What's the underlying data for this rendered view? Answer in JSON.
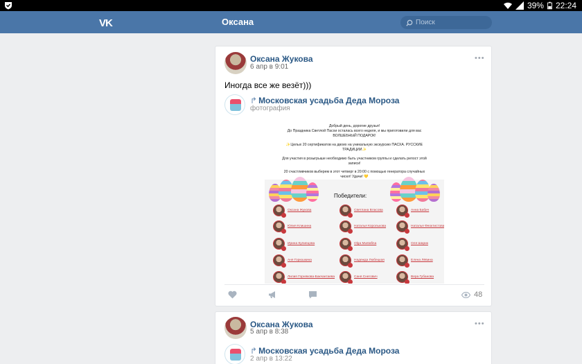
{
  "status_bar": {
    "battery": "39%",
    "time": "22:24"
  },
  "header": {
    "logo": "VK",
    "title": "Оксана",
    "search_placeholder": "Поиск"
  },
  "posts": [
    {
      "author": "Оксана Жукова",
      "date": "6 апр в 9:01",
      "text": "Иногда все же везёт)))",
      "repost": {
        "group": "Московская усадьба Деда Мороза",
        "type": "фотография"
      },
      "image": {
        "lines": [
          "Добрый день, дорогие друзья!",
          "До Праздника Светлой Пасхи осталась всего неделя, и мы приготовили для вас",
          "ВОЛШЕБНЫЙ ПОДАРОК!",
          "✨Целых 20 сертификатов на двоих на уникальную экскурсию ПАСХА. РУССКИЕ",
          "ТРАДИЦИИ✨",
          "Для участия в розыгрыше необходимо быть участником группы и сделать репост этой",
          "записи!",
          "20 счастливчиков выберем в этот четверг в 20:00 с помощью генератора случайных",
          "чисел! Удачи! 💛"
        ],
        "winners_title": "Победители:",
        "winners": [
          [
            "Оксана Жукова",
            "Светлана Власова",
            "Анна Бабич"
          ],
          [
            "Юлия Клишина",
            "Наталья Королькова",
            "Наталья Феоктистова"
          ],
          [
            "Ирина Кулиецова",
            "Olga Mustafina",
            "Оля Шарик"
          ],
          [
            "Аня Горюшкина",
            "Надежда Любецкая",
            "Елена Лёвина"
          ],
          [
            "Лилия Горнякова-Бакчантаева",
            "Саня Снегович",
            "Вера Губанова"
          ]
        ]
      },
      "views": "48"
    },
    {
      "author": "Оксана Жукова",
      "date": "5 апр в 8:38",
      "repost": {
        "group": "Московская усадьба Деда Мороза",
        "date": "2 апр в 13:22"
      }
    }
  ],
  "colors": {
    "header": "#4a76a8",
    "link": "#2a5885",
    "accent_red": "#c8383d"
  }
}
